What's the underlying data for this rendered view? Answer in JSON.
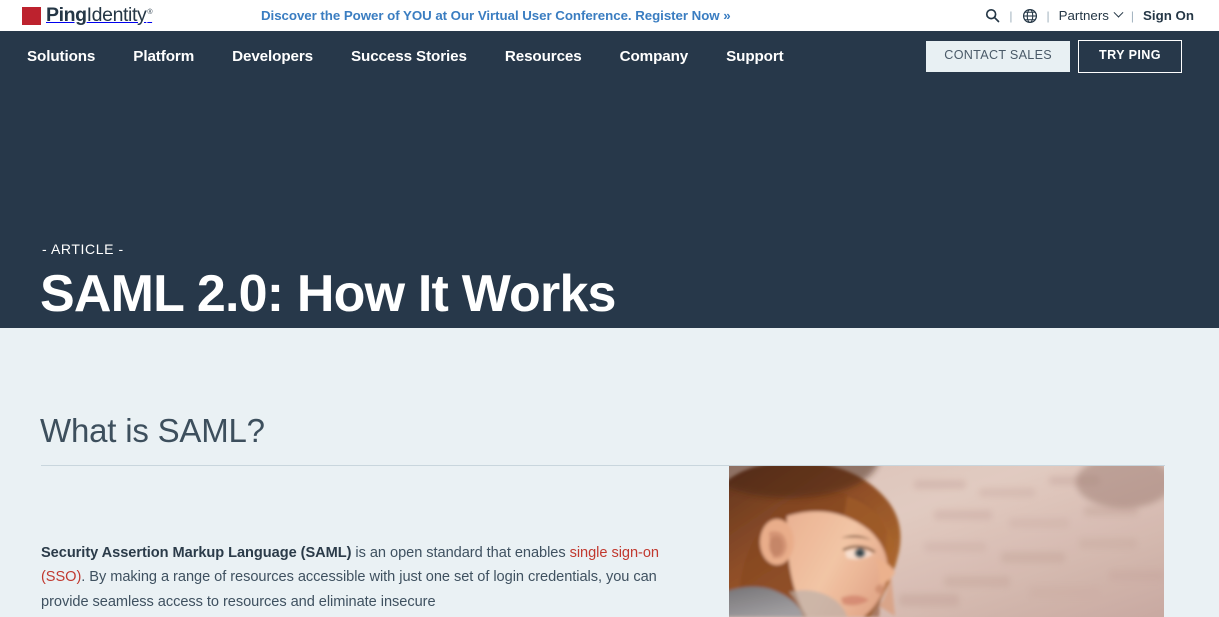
{
  "brand": {
    "logo_bold": "Ping",
    "logo_light": "Identity",
    "logo_tm": "®",
    "logo_mark": "red-square",
    "red": "#bd222e",
    "navy": "#27384a",
    "page_bg": "#eaf1f4",
    "link_red": "#c1392f",
    "announce_blue": "#3a7dc1"
  },
  "topbar": {
    "announcement": "Discover the Power of YOU at Our Virtual User Conference. Register Now »",
    "search_icon": "search-icon",
    "globe_icon": "globe-icon",
    "separator": "|",
    "partners_label": "Partners",
    "partners_chevron": "chevron-down-icon",
    "signon_label": "Sign On"
  },
  "mainnav": {
    "items": [
      {
        "label": "Solutions"
      },
      {
        "label": "Platform"
      },
      {
        "label": "Developers"
      },
      {
        "label": "Success Stories"
      },
      {
        "label": "Resources"
      },
      {
        "label": "Company"
      },
      {
        "label": "Support"
      }
    ],
    "contact_sales_label": "CONTACT SALES",
    "try_ping_label": "TRY PING"
  },
  "hero": {
    "eyebrow": "- ARTICLE -",
    "title": "SAML 2.0: How It Works"
  },
  "content": {
    "section_heading": "What is SAML?",
    "paragraph": {
      "lead_bold": "Security Assertion Markup Language (SAML)",
      "part_1": " is an open standard that enables ",
      "link_text": "single sign-on (SSO)",
      "part_2": ". By making a range of resources accessible with just one set of login credentials, you can provide seamless access to resources and eliminate insecure"
    },
    "photo_alt": "woman-in-profile-photo"
  }
}
